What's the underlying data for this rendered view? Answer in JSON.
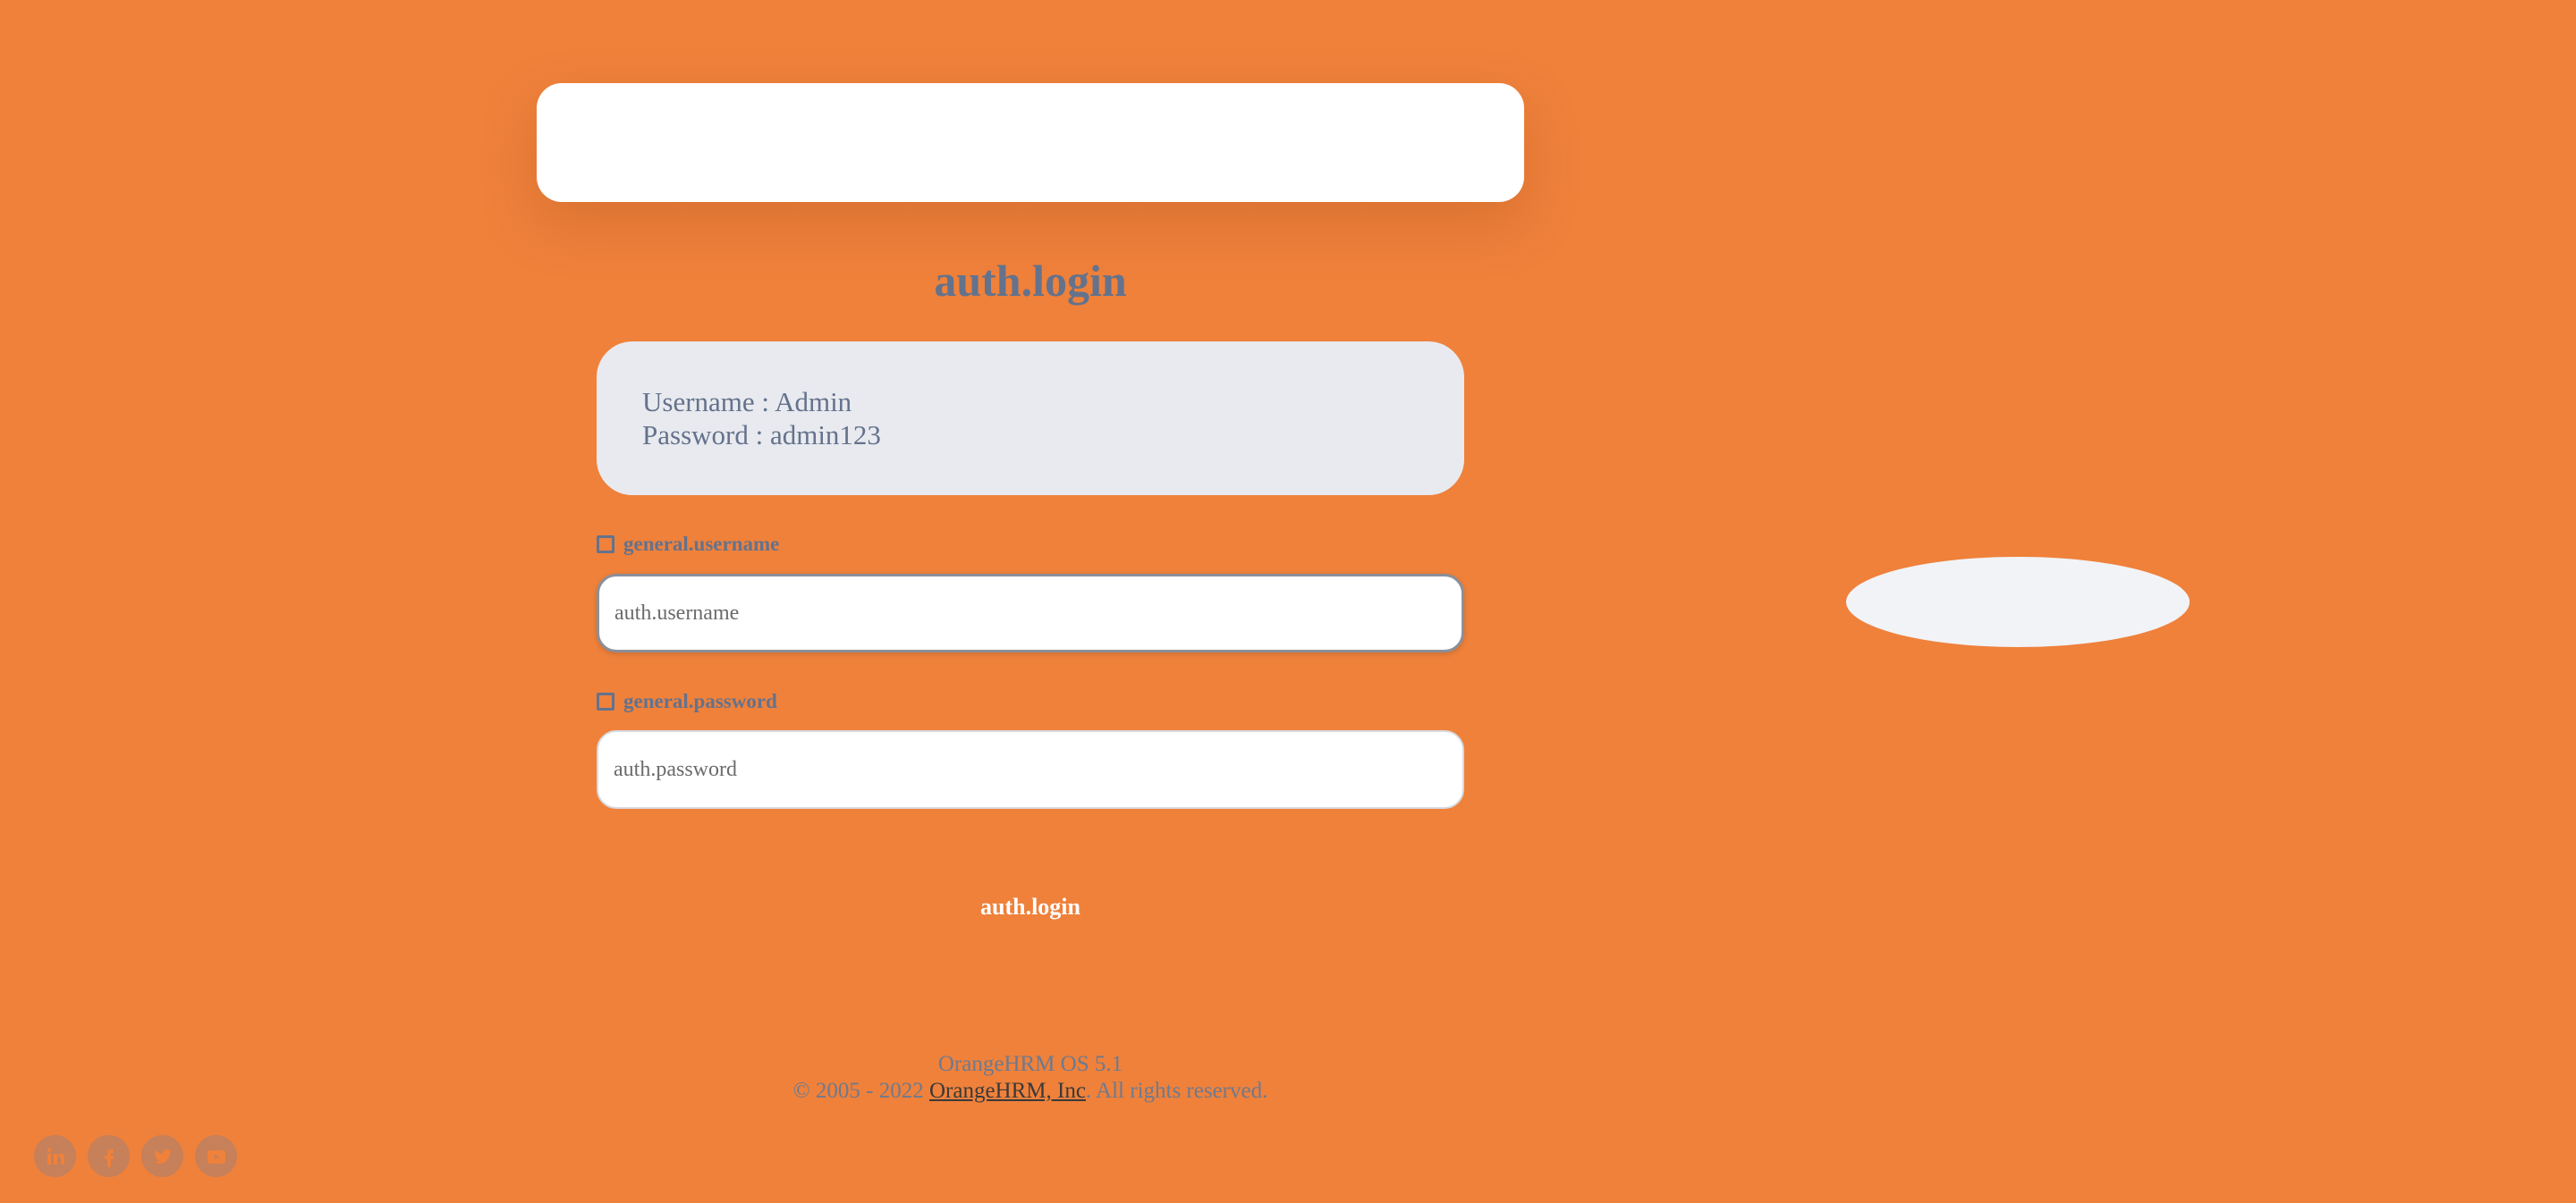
{
  "login": {
    "title": "auth.login",
    "credentials": {
      "username_line": "Username : Admin",
      "password_line": "Password : admin123"
    },
    "username": {
      "label": "general.username",
      "placeholder": "auth.username",
      "value": ""
    },
    "password": {
      "label": "general.password",
      "placeholder": "auth.password",
      "value": ""
    },
    "submit_label": "auth.login"
  },
  "footer": {
    "version": "OrangeHRM OS 5.1",
    "copyright_prefix": "© 2005 - 2022 ",
    "company_link": "OrangeHRM, Inc",
    "copyright_suffix": ". All rights reserved."
  },
  "socials": [
    "linkedin-icon",
    "facebook-icon",
    "twitter-icon",
    "youtube-icon"
  ],
  "colors": {
    "background": "#ef813b",
    "text": "#64728c",
    "card": "#e8eaef"
  }
}
